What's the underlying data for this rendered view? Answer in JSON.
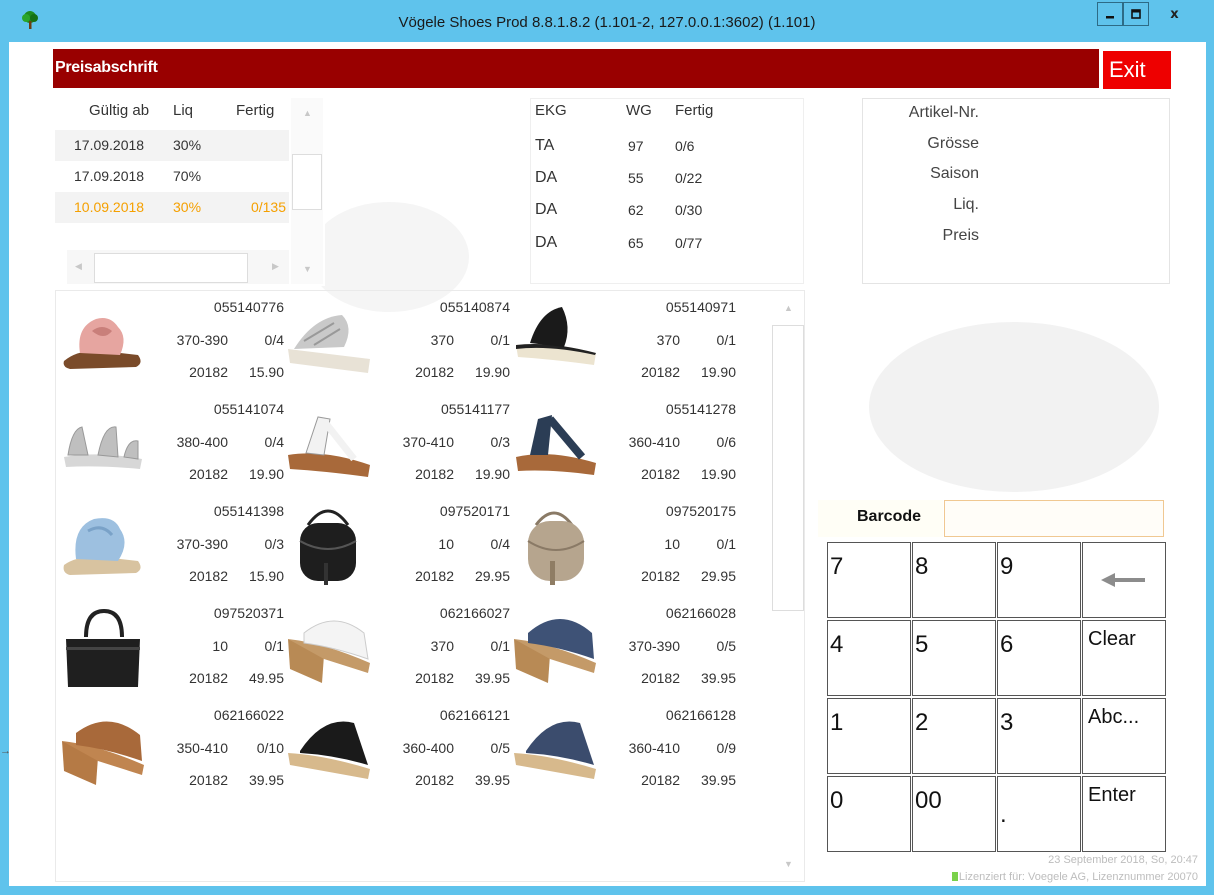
{
  "window": {
    "title": "Vögele Shoes Prod 8.8.1.8.2 (1.101-2, 127.0.0.1:3602) (1.101)",
    "close_glyph": "x"
  },
  "header": {
    "title": "Preisabschrift",
    "exit_label": "Exit"
  },
  "colors": {
    "header": "#990000",
    "exit": "#ee0000",
    "highlight": "#f5a000",
    "titlebar": "#5fc3ec"
  },
  "dates_table": {
    "headers": [
      "Gültig ab",
      "Liq",
      "Fertig"
    ],
    "rows": [
      {
        "date": "17.09.2018",
        "liq": "30%",
        "fertig": "",
        "highlight": false
      },
      {
        "date": "17.09.2018",
        "liq": "70%",
        "fertig": "",
        "highlight": false
      },
      {
        "date": "10.09.2018",
        "liq": "30%",
        "fertig": "0/135",
        "highlight": true
      }
    ]
  },
  "ekg_table": {
    "headers": [
      "EKG",
      "WG",
      "Fertig"
    ],
    "rows": [
      {
        "ekg": "TA",
        "wg": "97",
        "fertig": "0/6"
      },
      {
        "ekg": "DA",
        "wg": "55",
        "fertig": "0/22"
      },
      {
        "ekg": "DA",
        "wg": "62",
        "fertig": "0/30"
      },
      {
        "ekg": "DA",
        "wg": "65",
        "fertig": "0/77"
      }
    ]
  },
  "article_info": {
    "labels": [
      "Artikel-Nr.",
      "Grösse",
      "Saison",
      "Liq.",
      "Preis"
    ]
  },
  "products": [
    {
      "article": "055140776",
      "size": "370-390",
      "stock": "0/4",
      "season": "20182",
      "price": "15.90",
      "image": "pink-slide-sandal"
    },
    {
      "article": "055140874",
      "size": "370",
      "stock": "0/1",
      "season": "20182",
      "price": "19.90",
      "image": "silver-wedge-sandal"
    },
    {
      "article": "055140971",
      "size": "370",
      "stock": "0/1",
      "season": "20182",
      "price": "19.90",
      "image": "black-platform-sandal"
    },
    {
      "article": "055141074",
      "size": "380-400",
      "stock": "0/4",
      "season": "20182",
      "price": "19.90",
      "image": "silver-strap-sandal"
    },
    {
      "article": "055141177",
      "size": "370-410",
      "stock": "0/3",
      "season": "20182",
      "price": "19.90",
      "image": "white-thong-sandal"
    },
    {
      "article": "055141278",
      "size": "360-410",
      "stock": "0/6",
      "season": "20182",
      "price": "19.90",
      "image": "navy-thong-sandal"
    },
    {
      "article": "055141398",
      "size": "370-390",
      "stock": "0/3",
      "season": "20182",
      "price": "15.90",
      "image": "blue-slide-sandal"
    },
    {
      "article": "097520171",
      "size": "10",
      "stock": "0/4",
      "season": "20182",
      "price": "29.95",
      "image": "black-crossbody-bag"
    },
    {
      "article": "097520175",
      "size": "10",
      "stock": "0/1",
      "season": "20182",
      "price": "29.95",
      "image": "taupe-crossbody-bag"
    },
    {
      "article": "097520371",
      "size": "10",
      "stock": "0/1",
      "season": "20182",
      "price": "49.95",
      "image": "black-handbag"
    },
    {
      "article": "062166027",
      "size": "370",
      "stock": "0/1",
      "season": "20182",
      "price": "39.95",
      "image": "white-wedge-mule"
    },
    {
      "article": "062166028",
      "size": "370-390",
      "stock": "0/5",
      "season": "20182",
      "price": "39.95",
      "image": "blue-wedge-mule"
    },
    {
      "article": "062166022",
      "size": "350-410",
      "stock": "0/10",
      "season": "20182",
      "price": "39.95",
      "image": "tan-wedge-mule"
    },
    {
      "article": "062166121",
      "size": "360-400",
      "stock": "0/5",
      "season": "20182",
      "price": "39.95",
      "image": "black-wedge-mule"
    },
    {
      "article": "062166128",
      "size": "360-410",
      "stock": "0/9",
      "season": "20182",
      "price": "39.95",
      "image": "navy-wedge-mule"
    }
  ],
  "barcode": {
    "label": "Barcode",
    "value": ""
  },
  "keypad": {
    "keys": [
      {
        "label": "7",
        "kind": "digit"
      },
      {
        "label": "8",
        "kind": "digit"
      },
      {
        "label": "9",
        "kind": "digit"
      },
      {
        "label": "",
        "kind": "backspace",
        "icon": "backspace-arrow-icon"
      },
      {
        "label": "4",
        "kind": "digit"
      },
      {
        "label": "5",
        "kind": "digit"
      },
      {
        "label": "6",
        "kind": "digit"
      },
      {
        "label": "Clear",
        "kind": "word"
      },
      {
        "label": "1",
        "kind": "digit"
      },
      {
        "label": "2",
        "kind": "digit"
      },
      {
        "label": "3",
        "kind": "digit"
      },
      {
        "label": "Abc...",
        "kind": "word"
      },
      {
        "label": "0",
        "kind": "digit"
      },
      {
        "label": "00",
        "kind": "digit"
      },
      {
        "label": ".",
        "kind": "digit"
      },
      {
        "label": "Enter",
        "kind": "word"
      }
    ]
  },
  "status": {
    "datetime": "23 September 2018, So, 20:47",
    "license": "Lizenziert für: Voegele AG, Lizenznummer 20070"
  }
}
